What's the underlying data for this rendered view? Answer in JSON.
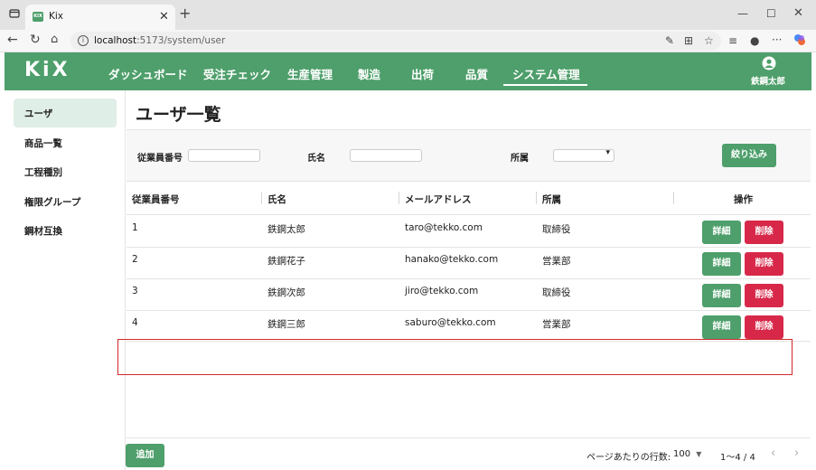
{
  "browser": {
    "tab_title": "Kix",
    "tab_favicon_text": "KIX",
    "url_host": "localhost",
    "url_rest": ":5173/system/user"
  },
  "app": {
    "logo": "KiX",
    "nav": [
      "ダッシュボード",
      "受注チェック",
      "生産管理",
      "製造",
      "出荷",
      "品質",
      "システム管理"
    ],
    "active_nav": "システム管理",
    "user_name": "鉄鋼太郎"
  },
  "sidebar": {
    "items": [
      "ユーザ",
      "商品一覧",
      "工程種別",
      "権限グループ",
      "鋼材互換"
    ],
    "active": "ユーザ"
  },
  "main": {
    "title": "ユーザ一覧",
    "filters": {
      "employee_no_label": "従業員番号",
      "name_label": "氏名",
      "dept_label": "所属",
      "submit_label": "絞り込み"
    },
    "table": {
      "headers": [
        "従業員番号",
        "氏名",
        "メールアドレス",
        "所属",
        "操作"
      ],
      "rows": [
        {
          "no": "1",
          "name": "鉄鋼太郎",
          "email": "taro@tekko.com",
          "dept": "取締役"
        },
        {
          "no": "2",
          "name": "鉄鋼花子",
          "email": "hanako@tekko.com",
          "dept": "営業部"
        },
        {
          "no": "3",
          "name": "鉄鋼次郎",
          "email": "jiro@tekko.com",
          "dept": "取締役"
        },
        {
          "no": "4",
          "name": "鉄鋼三郎",
          "email": "saburo@tekko.com",
          "dept": "営業部"
        }
      ],
      "detail_label": "詳細",
      "delete_label": "削除"
    },
    "footer": {
      "add_label": "追加",
      "rows_per_page_label": "ページあたりの行数:",
      "rows_per_page_value": "100",
      "range": "1〜4 / 4"
    }
  },
  "colors": {
    "accent": "#4e9f6b",
    "danger": "#d8284a",
    "highlight": "#d0282e"
  }
}
